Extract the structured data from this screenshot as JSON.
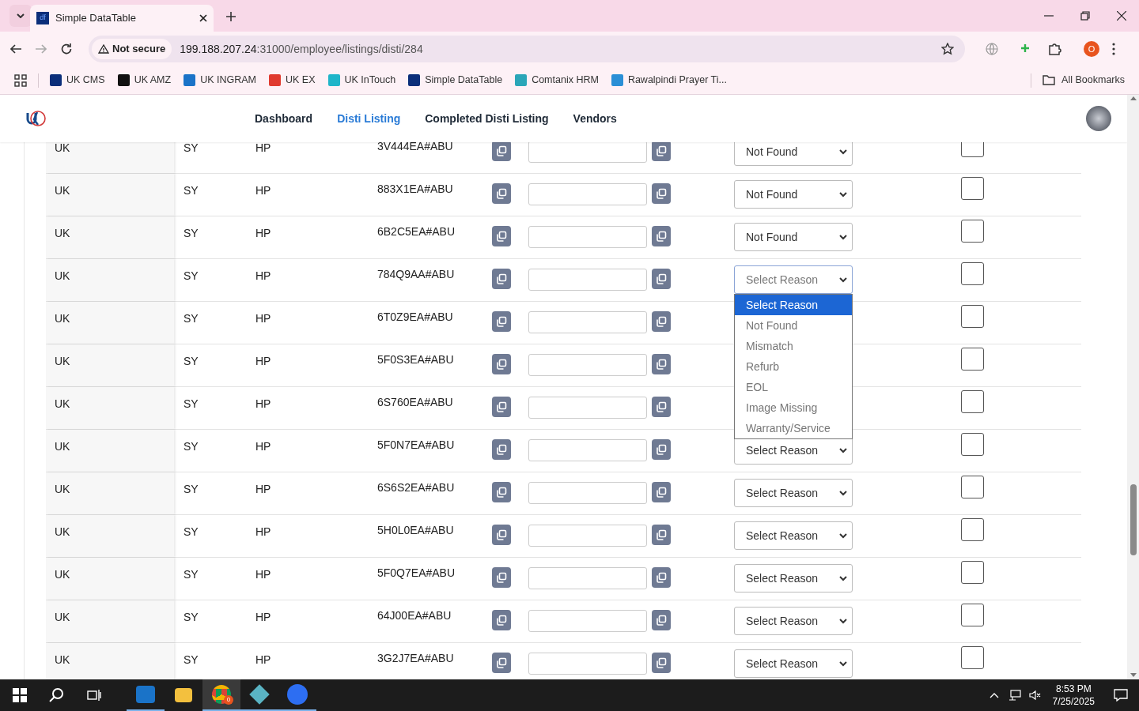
{
  "browser": {
    "tab": {
      "title": "Simple DataTable",
      "favicon": "df"
    },
    "address": {
      "security": "Not secure",
      "host": "199.188.207.24",
      "path": ":31000/employee/listings/disti/284"
    },
    "profile": "O",
    "bookmarks": [
      {
        "label": "UK CMS",
        "color": "#0b2e7a"
      },
      {
        "label": "UK AMZ",
        "color": "#111111"
      },
      {
        "label": "UK INGRAM",
        "color": "#1a73c8"
      },
      {
        "label": "UK EX",
        "color": "#e03a2f"
      },
      {
        "label": "UK InTouch",
        "color": "#1fb5c9"
      },
      {
        "label": "Simple DataTable",
        "color": "#0b2e7a"
      },
      {
        "label": "Comtanix HRM",
        "color": "#2aa6b8"
      },
      {
        "label": "Rawalpindi Prayer Ti...",
        "color": "#2a8fd6"
      }
    ],
    "all_bookmarks": "All Bookmarks"
  },
  "nav": {
    "links": [
      {
        "label": "Dashboard",
        "selected": false
      },
      {
        "label": "Disti Listing",
        "selected": true
      },
      {
        "label": "Completed Disti Listing",
        "selected": false
      },
      {
        "label": "Vendors",
        "selected": false
      }
    ]
  },
  "rows": [
    {
      "country": "UK",
      "code": "SY",
      "brand": "HP",
      "part": "3V444EA#ABU",
      "select": {
        "value": "Not Found",
        "focused": false
      },
      "checked": false
    },
    {
      "country": "UK",
      "code": "SY",
      "brand": "HP",
      "part": "883X1EA#ABU",
      "select": {
        "value": "Not Found",
        "focused": false
      },
      "checked": false
    },
    {
      "country": "UK",
      "code": "SY",
      "brand": "HP",
      "part": "6B2C5EA#ABU",
      "select": {
        "value": "Not Found",
        "focused": false
      },
      "checked": false
    },
    {
      "country": "UK",
      "code": "SY",
      "brand": "HP",
      "part": "784Q9AA#ABU",
      "select": {
        "value": "Select Reason",
        "focused": true
      },
      "checked": false
    },
    {
      "country": "UK",
      "code": "SY",
      "brand": "HP",
      "part": "6T0Z9EA#ABU",
      "checked": false
    },
    {
      "country": "UK",
      "code": "SY",
      "brand": "HP",
      "part": "5F0S3EA#ABU",
      "checked": false
    },
    {
      "country": "UK",
      "code": "SY",
      "brand": "HP",
      "part": "6S760EA#ABU",
      "checked": false
    },
    {
      "country": "UK",
      "code": "SY",
      "brand": "HP",
      "part": "5F0N7EA#ABU",
      "select": {
        "value": "Select Reason",
        "focused": false
      },
      "checked": false
    },
    {
      "country": "UK",
      "code": "SY",
      "brand": "HP",
      "part": "6S6S2EA#ABU",
      "select": {
        "value": "Select Reason",
        "focused": false
      },
      "checked": false
    },
    {
      "country": "UK",
      "code": "SY",
      "brand": "HP",
      "part": "5H0L0EA#ABU",
      "select": {
        "value": "Select Reason",
        "focused": false
      },
      "checked": false
    },
    {
      "country": "UK",
      "code": "SY",
      "brand": "HP",
      "part": "5F0Q7EA#ABU",
      "select": {
        "value": "Select Reason",
        "focused": false
      },
      "checked": false
    },
    {
      "country": "UK",
      "code": "SY",
      "brand": "HP",
      "part": "64J00EA#ABU",
      "select": {
        "value": "Select Reason",
        "focused": false
      },
      "checked": false
    },
    {
      "country": "UK",
      "code": "SY",
      "brand": "HP",
      "part": "3G2J7EA#ABU",
      "select": {
        "value": "Select Reason",
        "focused": false
      },
      "checked": false
    }
  ],
  "dropdown": {
    "options": [
      {
        "label": "Select Reason",
        "selected": true
      },
      {
        "label": "Not Found",
        "selected": false
      },
      {
        "label": "Mismatch",
        "selected": false
      },
      {
        "label": "Refurb",
        "selected": false
      },
      {
        "label": "EOL",
        "selected": false
      },
      {
        "label": "Image Missing",
        "selected": false
      },
      {
        "label": "Warranty/Service",
        "selected": false
      }
    ]
  },
  "taskbar": {
    "time": "8:53 PM",
    "date": "7/25/2025",
    "chrome_badge": "0"
  }
}
